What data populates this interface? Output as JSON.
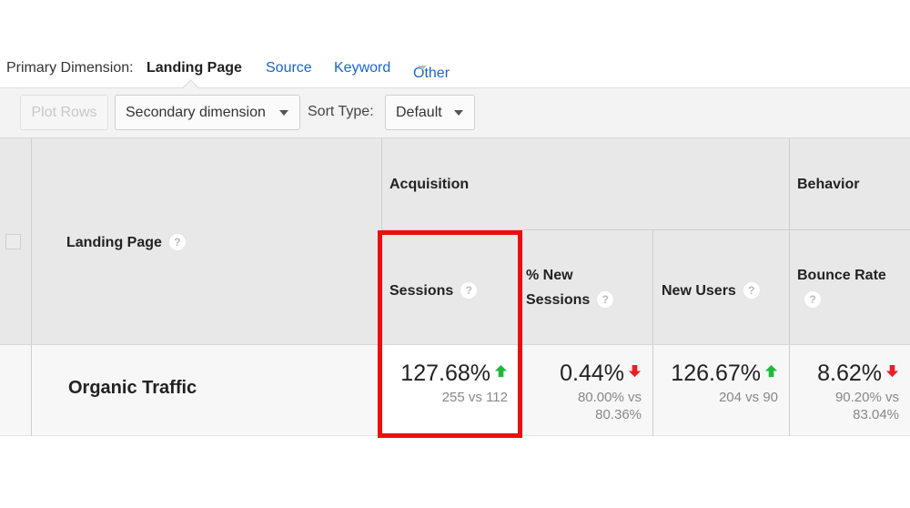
{
  "dimension_bar": {
    "label": "Primary Dimension:",
    "active": "Landing Page",
    "links": [
      "Source",
      "Keyword",
      "Other"
    ]
  },
  "toolbar": {
    "plot_rows": "Plot Rows",
    "secondary_dimension": "Secondary dimension",
    "sort_type_label": "Sort Type:",
    "sort_type_value": "Default"
  },
  "table": {
    "headers": {
      "landing_page": "Landing Page",
      "acquisition": "Acquisition",
      "behavior": "Behavior",
      "sessions": "Sessions",
      "new_sessions_line1": "% New",
      "new_sessions_line2": "Sessions",
      "new_users": "New Users",
      "bounce_rate": "Bounce Rate",
      "help_glyph": "?"
    },
    "row": {
      "label": "Organic Traffic",
      "sessions": {
        "change": "127.68%",
        "direction": "up",
        "compare": "255 vs 112"
      },
      "new_sessions": {
        "change": "0.44%",
        "direction": "down",
        "compare_line1": "80.00% vs",
        "compare_line2": "80.36%"
      },
      "new_users": {
        "change": "126.67%",
        "direction": "up",
        "compare": "204 vs 90"
      },
      "bounce_rate": {
        "change": "8.62%",
        "direction": "down",
        "compare_line1": "90.20% vs",
        "compare_line2": "83.04%"
      }
    }
  },
  "colors": {
    "link": "#1a66c9",
    "up_arrow": "#1fb83a",
    "down_arrow": "#ee1c25",
    "highlight_box": "#ee0d0d",
    "header_bg": "#e8e8e8"
  }
}
